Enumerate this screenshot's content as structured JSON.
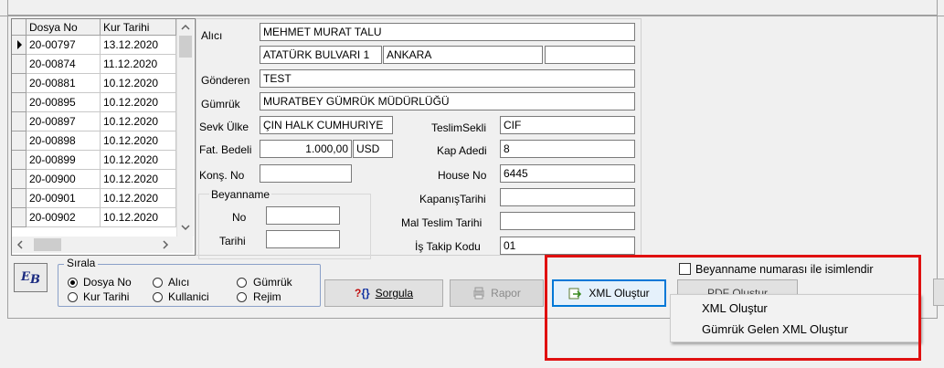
{
  "grid": {
    "columns": [
      "Dosya No",
      "Kur Tarihi"
    ],
    "rows": [
      {
        "no": "20-00797",
        "date": "13.12.2020"
      },
      {
        "no": "20-00874",
        "date": "11.12.2020"
      },
      {
        "no": "20-00881",
        "date": "10.12.2020"
      },
      {
        "no": "20-00895",
        "date": "10.12.2020"
      },
      {
        "no": "20-00897",
        "date": "10.12.2020"
      },
      {
        "no": "20-00898",
        "date": "10.12.2020"
      },
      {
        "no": "20-00899",
        "date": "10.12.2020"
      },
      {
        "no": "20-00900",
        "date": "10.12.2020"
      },
      {
        "no": "20-00901",
        "date": "10.12.2020"
      },
      {
        "no": "20-00902",
        "date": "10.12.2020"
      }
    ]
  },
  "form": {
    "alici_label": "Alıcı",
    "alici_name": "MEHMET MURAT TALU",
    "alici_address": "ATATÜRK BULVARI 1",
    "alici_city": "ANKARA",
    "alici_extra": "",
    "gonderen_label": "Gönderen",
    "gonderen": "TEST",
    "gumruk_label": "Gümrük",
    "gumruk": "MURATBEY GÜMRÜK MÜDÜRLÜĞÜ",
    "sevk_label": "Sevk Ülke",
    "sevk": "ÇIN HALK CUMHURIYE",
    "fat_label": "Fat. Bedeli",
    "fat_value": "1.000,00",
    "currency": "USD",
    "kons_label": "Konş. No",
    "kons": "",
    "beyanname_label": "Beyanname",
    "beyan_no_label": "No",
    "beyan_no": "",
    "beyan_tarih_label": "Tarihi",
    "beyan_tarih": "",
    "teslim_label": "TeslimSekli",
    "teslim": "CIF",
    "kap_label": "Kap Adedi",
    "kap": "8",
    "house_label": "House No",
    "house": "6445",
    "kapanis_label": "KapanışTarihi",
    "kapanis": "",
    "mal_label": "Mal Teslim Tarihi",
    "mal": "",
    "is_takip_label": "İş Takip Kodu",
    "is_takip": "01"
  },
  "sirala": {
    "title": "Sırala",
    "options": [
      "Dosya No",
      "Alıcı",
      "Gümrük",
      "Kur Tarihi",
      "Kullanici",
      "Rejim"
    ],
    "selected": "Dosya No"
  },
  "logo_text": "EB",
  "buttons": {
    "sorgula": "Sorgula",
    "rapor": "Rapor",
    "xml": "XML Oluştur",
    "pdf": "PDF Oluştur"
  },
  "checkbox_label": "Beyanname numarası ile isimlendir",
  "menu": [
    "XML Oluştur",
    "Gümrük Gelen XML Oluştur"
  ],
  "colors": {
    "highlight_box": "#e01010",
    "focus_border": "#0078d7"
  }
}
